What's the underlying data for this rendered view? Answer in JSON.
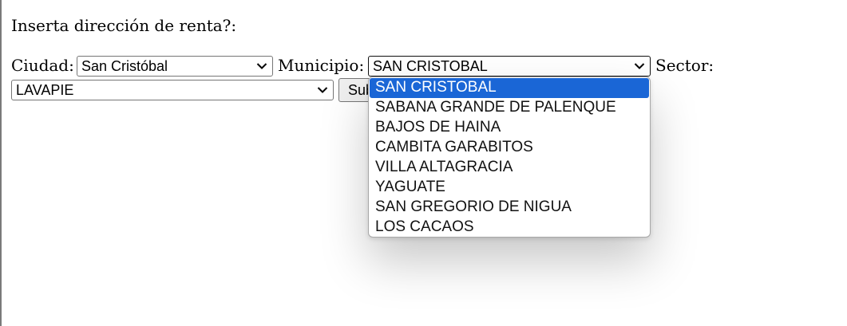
{
  "form": {
    "prompt": "Inserta dirección de renta?:",
    "ciudad_label": "Ciudad:",
    "ciudad_value": "San Cristóbal",
    "municipio_label": "Municipio:",
    "municipio_value": "SAN CRISTOBAL",
    "sector_label": "Sector:",
    "sector_value": "LAVAPIE",
    "submit_label": "Submit"
  },
  "municipio_dropdown": {
    "selected_index": 0,
    "options": [
      "SAN CRISTOBAL",
      "SABANA GRANDE DE PALENQUE",
      "BAJOS DE HAINA",
      "CAMBITA GARABITOS",
      "VILLA ALTAGRACIA",
      "YAGUATE",
      "SAN GREGORIO DE NIGUA",
      "LOS CACAOS"
    ]
  },
  "icons": {
    "select_arrow": "chevron-down-icon"
  },
  "colors": {
    "selected_option_bg": "#1a66d6",
    "selected_option_text": "#ffffff"
  }
}
